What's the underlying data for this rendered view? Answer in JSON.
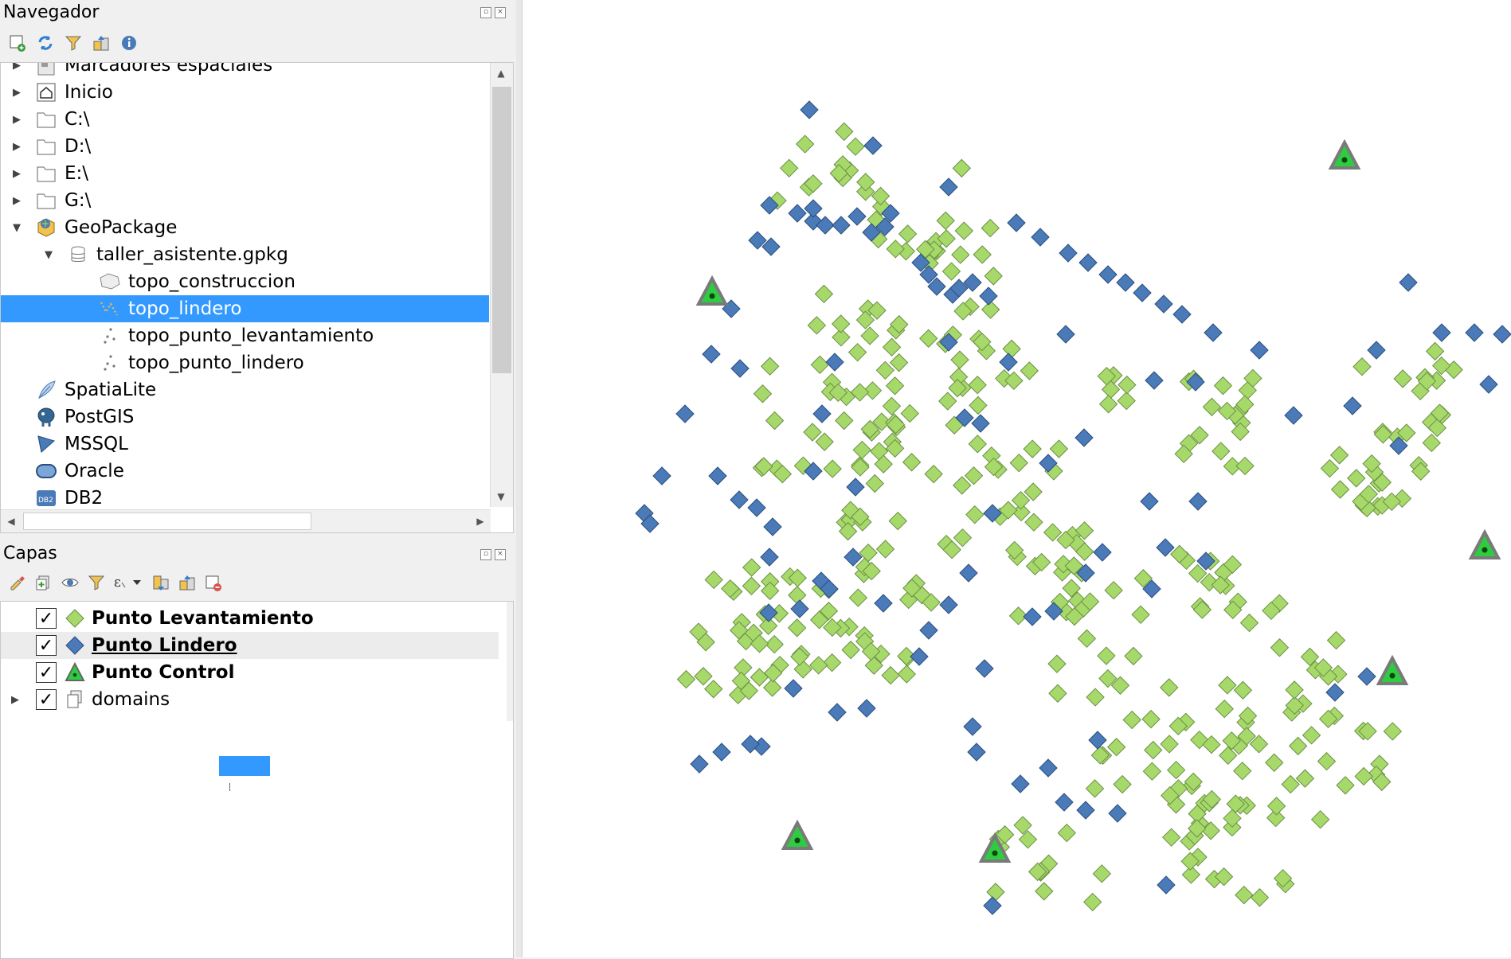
{
  "browser_panel": {
    "title": "Navegador",
    "toolbar": [
      {
        "icon": "add-layer-icon"
      },
      {
        "icon": "refresh-icon"
      },
      {
        "icon": "filter-icon"
      },
      {
        "icon": "collapse-all-icon"
      },
      {
        "icon": "info-icon"
      }
    ],
    "items": [
      {
        "label": "Marcadores espaciales",
        "icon": "bookmarks-icon",
        "expander": "collapsed"
      },
      {
        "label": "Inicio",
        "icon": "home-folder-icon",
        "expander": "collapsed"
      },
      {
        "label": "C:\\",
        "icon": "folder-icon",
        "expander": "collapsed"
      },
      {
        "label": "D:\\",
        "icon": "folder-icon",
        "expander": "collapsed"
      },
      {
        "label": "E:\\",
        "icon": "folder-icon",
        "expander": "collapsed"
      },
      {
        "label": "G:\\",
        "icon": "folder-icon",
        "expander": "collapsed"
      },
      {
        "label": "GeoPackage",
        "icon": "geopackage-icon",
        "expander": "expanded"
      },
      {
        "label": "taller_asistente.gpkg",
        "icon": "database-icon",
        "expander": "expanded"
      },
      {
        "label": "topo_construccion",
        "icon": "polygon-layer-icon",
        "expander": "none"
      },
      {
        "label": "topo_lindero",
        "icon": "line-layer-icon",
        "expander": "none",
        "selected": true
      },
      {
        "label": "topo_punto_levantamiento",
        "icon": "point-layer-icon",
        "expander": "none"
      },
      {
        "label": "topo_punto_lindero",
        "icon": "point-layer-icon",
        "expander": "none"
      },
      {
        "label": "SpatiaLite",
        "icon": "spatialite-icon",
        "expander": "none"
      },
      {
        "label": "PostGIS",
        "icon": "postgis-icon",
        "expander": "none"
      },
      {
        "label": "MSSQL",
        "icon": "mssql-icon",
        "expander": "none"
      },
      {
        "label": "Oracle",
        "icon": "oracle-icon",
        "expander": "none"
      },
      {
        "label": "DB2",
        "icon": "db2-icon",
        "expander": "none"
      }
    ]
  },
  "layers_panel": {
    "title": "Capas",
    "toolbar": [
      {
        "icon": "style-icon"
      },
      {
        "icon": "add-group-icon"
      },
      {
        "icon": "visibility-icon"
      },
      {
        "icon": "filter-legend-icon"
      },
      {
        "icon": "expression-filter-icon"
      },
      {
        "icon": "expand-all-icon"
      },
      {
        "icon": "collapse-all-icon"
      },
      {
        "icon": "remove-layer-icon"
      }
    ],
    "layers": [
      {
        "name": "Punto Levantamiento",
        "checked": true,
        "symbol": "green-diamond-icon",
        "bold": true,
        "underline": false,
        "color": "#a6d96a"
      },
      {
        "name": "Punto Lindero",
        "checked": true,
        "symbol": "blue-diamond-icon",
        "bold": true,
        "underline": true,
        "color": "#4a7ab8",
        "highlighted": true
      },
      {
        "name": "Punto Control",
        "checked": true,
        "symbol": "green-triangle-icon",
        "bold": true,
        "underline": false,
        "color": "#2ecc40"
      },
      {
        "name": "domains",
        "checked": true,
        "symbol": "group-icon",
        "bold": false,
        "underline": false,
        "expander": "collapsed"
      }
    ]
  },
  "colors": {
    "selection": "#3399ff",
    "levantamiento_fill": "#a6d96a",
    "lindero_fill": "#4a7ab8",
    "control_fill": "#2ecc40",
    "control_outline": "#7a7a7a"
  }
}
